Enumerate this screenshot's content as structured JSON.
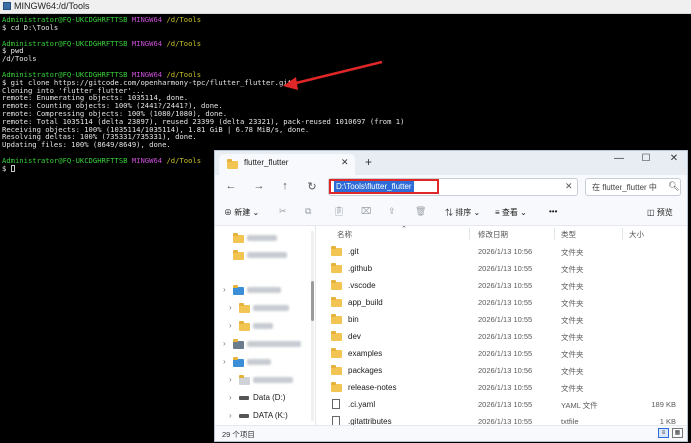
{
  "terminal": {
    "title": "MINGW64:/d/Tools",
    "lines": [
      {
        "user": "Administrator@FQ-UKCDGHRFTTSB",
        "shell": "MINGW64",
        "path": "/d/Tools"
      },
      {
        "text": "$ cd D:\\Tools"
      },
      {
        "user": "Administrator@FQ-UKCDGHRFTTSB",
        "shell": "MINGW64",
        "path": "/d/Tools"
      },
      {
        "text": "$ pwd"
      },
      {
        "text": "/d/Tools"
      },
      {
        "user": "Administrator@FQ-UKCDGHRFTTSB",
        "shell": "MINGW64",
        "path": "/d/Tools"
      },
      {
        "text": "$ git clone https://gitcode.com/openharmony-tpc/flutter_flutter.git"
      },
      {
        "text": "Cloning into 'flutter_flutter'..."
      },
      {
        "text": "remote: Enumerating objects: 1035114, done."
      },
      {
        "text": "remote: Counting objects: 100% (2441?/2441?), done."
      },
      {
        "text": "remote: Compressing objects: 100% (1080/1080), done."
      },
      {
        "text": "remote: Total 1035114 (delta 23897), reused 23399 (delta 23321), pack-reused 1010697 (from 1)"
      },
      {
        "text": "Receiving objects: 100% (1035114/1035114), 1.81 GiB | 6.78 MiB/s, done."
      },
      {
        "text": "Resolving deltas: 100% (735331/735331), done."
      },
      {
        "text": "Updating files: 100% (8649/8649), done."
      },
      {
        "user": "Administrator@FQ-UKCDGHRFTTSB",
        "shell": "MINGW64",
        "path": "/d/Tools"
      },
      {
        "text": "$ "
      }
    ]
  },
  "explorer": {
    "tab_label": "flutter_flutter",
    "tab_close": "✕",
    "tab_add": "+",
    "window_buttons": [
      "—",
      "☐",
      "✕"
    ],
    "nav_buttons": [
      "←",
      "→",
      "↑",
      "↻"
    ],
    "address": "D:\\Tools\\flutter_flutter",
    "address_clear": "✕",
    "search_placeholder": "在 flutter_flutter 中",
    "toolbar": {
      "new_label": "新建",
      "sort_label": "排序",
      "view_label": "查看",
      "more_label": "•••",
      "preview_label": "预览"
    },
    "nav_pane": [
      {
        "label": "Data (D:)"
      },
      {
        "label": "DATA (K:)"
      }
    ],
    "columns": [
      "名称",
      "修改日期",
      "类型",
      "大小"
    ],
    "files": [
      {
        "name": ".git",
        "date": "2026/1/13 10:56",
        "type": "文件夹",
        "size": "",
        "kind": "folder"
      },
      {
        "name": ".github",
        "date": "2026/1/13 10:55",
        "type": "文件夹",
        "size": "",
        "kind": "folder"
      },
      {
        "name": ".vscode",
        "date": "2026/1/13 10:55",
        "type": "文件夹",
        "size": "",
        "kind": "folder"
      },
      {
        "name": "app_build",
        "date": "2026/1/13 10:55",
        "type": "文件夹",
        "size": "",
        "kind": "folder"
      },
      {
        "name": "bin",
        "date": "2026/1/13 10:55",
        "type": "文件夹",
        "size": "",
        "kind": "folder"
      },
      {
        "name": "dev",
        "date": "2026/1/13 10:55",
        "type": "文件夹",
        "size": "",
        "kind": "folder"
      },
      {
        "name": "examples",
        "date": "2026/1/13 10:55",
        "type": "文件夹",
        "size": "",
        "kind": "folder"
      },
      {
        "name": "packages",
        "date": "2026/1/13 10:56",
        "type": "文件夹",
        "size": "",
        "kind": "folder"
      },
      {
        "name": "release-notes",
        "date": "2026/1/13 10:55",
        "type": "文件夹",
        "size": "",
        "kind": "folder"
      },
      {
        "name": ".ci.yaml",
        "date": "2026/1/13 10:55",
        "type": "YAML 文件",
        "size": "189 KB",
        "kind": "file"
      },
      {
        "name": ".gitattributes",
        "date": "2026/1/13 10:55",
        "type": "txtfile",
        "size": "1 KB",
        "kind": "file"
      }
    ],
    "status": "29 个项目"
  },
  "colors": {
    "prompt_user": "#37d13a",
    "prompt_shell": "#c94fd6",
    "prompt_path": "#c9c12a",
    "annotation": "#e02727",
    "selection": "#2d6bd6"
  }
}
